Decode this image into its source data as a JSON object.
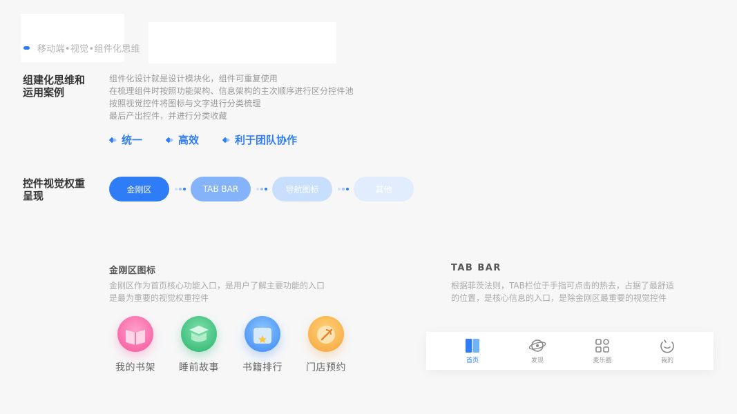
{
  "breadcrumb": "移动端•视觉•组件化思维",
  "section1": {
    "title_line1": "组建化思维和",
    "title_line2": "运用案例",
    "desc": [
      "组件化设计就是设计模块化，组件可重复使用",
      "在梳理组件时按照功能架构、信息架构的主次顺序进行区分控件池",
      "按照视觉控件将图标与文字进行分类梳理",
      "最后产出控件，并进行分类收藏"
    ],
    "tags": [
      "统一",
      "高效",
      "利于团队协作"
    ]
  },
  "section2": {
    "title_line1": "控件视觉权重",
    "title_line2": "呈现",
    "pills": [
      "金刚区",
      "TAB BAR",
      "导航图标",
      "其他"
    ]
  },
  "kingkong": {
    "title": "金刚区图标",
    "desc": [
      "金刚区作为首页核心功能入口，是用户了解主要功能的入口",
      "是最为重要的视觉权重控件"
    ],
    "items": [
      {
        "label": "我的书架",
        "icon": "bookshelf-icon",
        "color": "#f5559a"
      },
      {
        "label": "睡前故事",
        "icon": "story-icon",
        "color": "#28b46e"
      },
      {
        "label": "书籍排行",
        "icon": "ranking-icon",
        "color": "#3a86f0"
      },
      {
        "label": "门店预约",
        "icon": "store-icon",
        "color": "#f6a23a"
      }
    ]
  },
  "tabbar_section": {
    "title": "TAB BAR",
    "desc": [
      "根据菲茨法则，TAB栏位于手指可点击的热去，占据了最舒适",
      "的位置，是核心信息的入口，是除金刚区最重要的视觉控件"
    ],
    "tabs": [
      {
        "label": "首页",
        "icon": "home-icon",
        "active": true
      },
      {
        "label": "发现",
        "icon": "discover-icon",
        "active": false
      },
      {
        "label": "麦乐圈",
        "icon": "circle-icon",
        "active": false
      },
      {
        "label": "我的",
        "icon": "profile-icon",
        "active": false
      }
    ]
  },
  "colors": {
    "accent": "#2f7df6",
    "pill_2": "#84b3fa",
    "pill_3": "#c8defd",
    "pill_4": "#e1ecfd"
  }
}
